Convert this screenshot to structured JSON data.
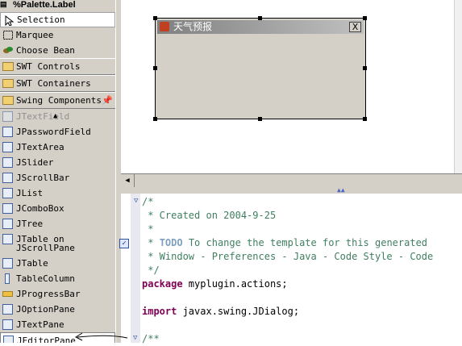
{
  "palette": {
    "title": "%Palette.Label",
    "tools": [
      {
        "label": "Selection",
        "icon": "arrow-pointer-icon"
      },
      {
        "label": "Marquee",
        "icon": "marquee-icon"
      },
      {
        "label": "Choose Bean",
        "icon": "bean-icon"
      }
    ],
    "drawers": [
      {
        "label": "SWT Controls"
      },
      {
        "label": "SWT Containers"
      },
      {
        "label": "Swing Components"
      }
    ],
    "components": [
      {
        "label": "JTextField"
      },
      {
        "label": "JPasswordField"
      },
      {
        "label": "JTextArea"
      },
      {
        "label": "JSlider"
      },
      {
        "label": "JScrollBar"
      },
      {
        "label": "JList"
      },
      {
        "label": "JComboBox"
      },
      {
        "label": "JTree"
      },
      {
        "label": "JTable on",
        "label2": "JScrollPane"
      },
      {
        "label": "JTable"
      },
      {
        "label": "TableColumn"
      },
      {
        "label": "JProgressBar"
      },
      {
        "label": "JOptionPane"
      },
      {
        "label": "JTextPane"
      },
      {
        "label": "JEditorPane"
      }
    ]
  },
  "design": {
    "dialog_title": "天气预报",
    "close_label": "X"
  },
  "editor": {
    "lines": [
      {
        "type": "cm",
        "text": "/*"
      },
      {
        "type": "cm",
        "text": " * Created on 2004-9-25"
      },
      {
        "type": "cm",
        "text": " *"
      },
      {
        "type": "todo",
        "pre": " * ",
        "todo": "TODO",
        "post": " To change the template for this generated"
      },
      {
        "type": "cm",
        "text": " * Window - Preferences - Java - Code Style - Code"
      },
      {
        "type": "cm",
        "text": " */"
      },
      {
        "type": "code",
        "kw": "package",
        "rest": " myplugin.actions;"
      },
      {
        "type": "blank",
        "text": ""
      },
      {
        "type": "code",
        "kw": "import",
        "rest": " javax.swing.JDialog;"
      },
      {
        "type": "blank",
        "text": ""
      },
      {
        "type": "cm",
        "text": "/**"
      }
    ]
  }
}
